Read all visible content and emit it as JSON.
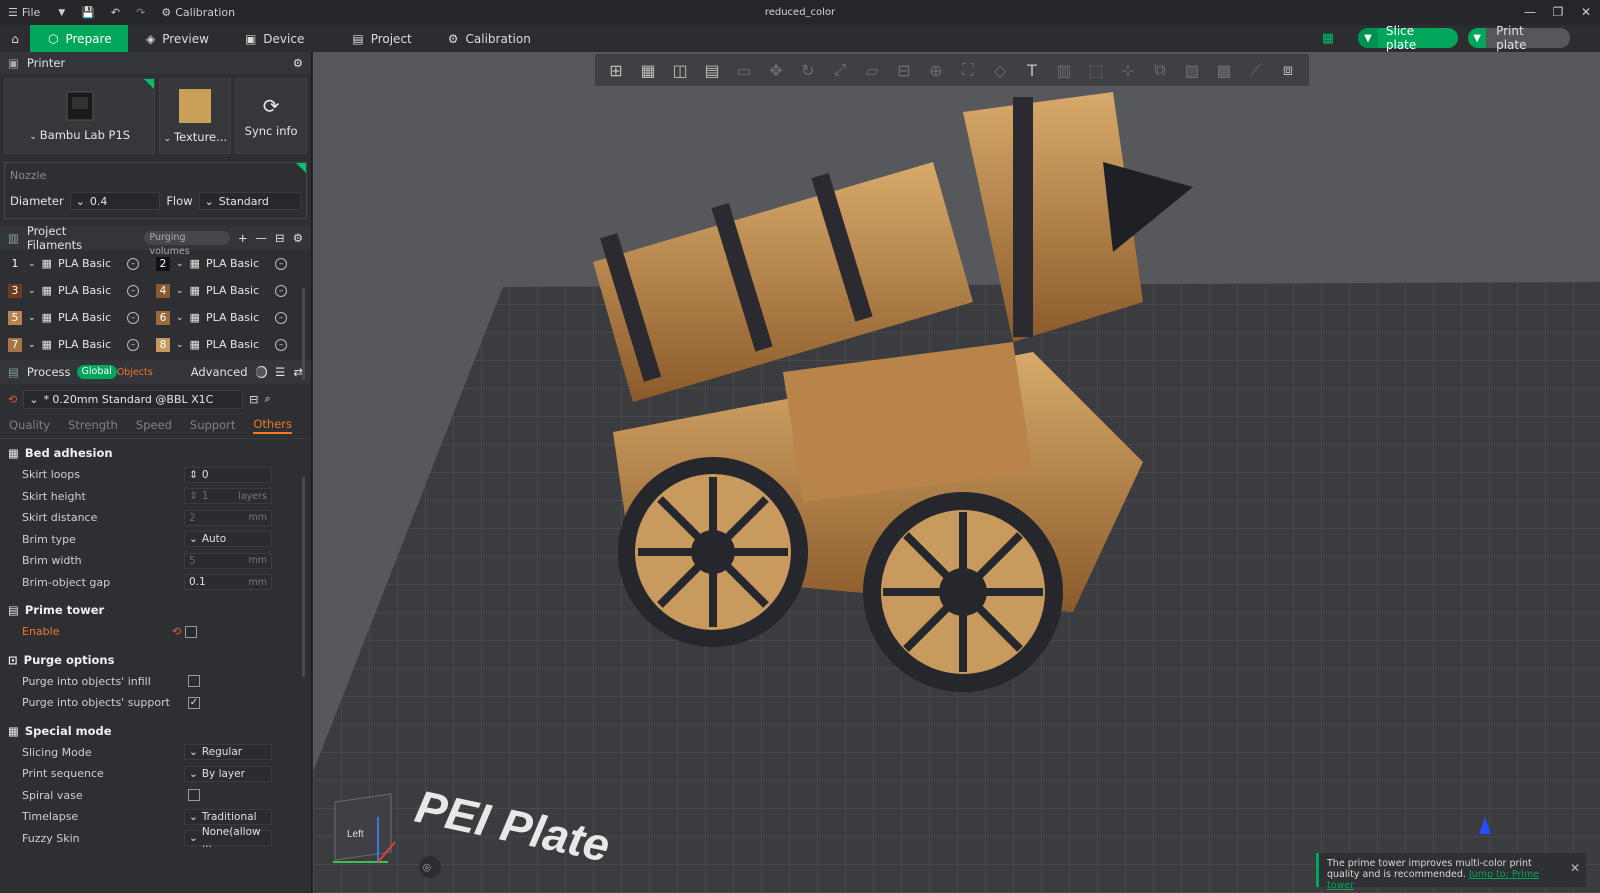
{
  "titlebar": {
    "file_label": "File",
    "calibration_label": "Calibration",
    "doc_title": "reduced_color"
  },
  "tabs": [
    {
      "label": "Prepare"
    },
    {
      "label": "Preview"
    },
    {
      "label": "Device"
    },
    {
      "label": "Project"
    },
    {
      "label": "Calibration"
    }
  ],
  "actions": {
    "slice": "Slice plate",
    "print": "Print plate"
  },
  "printer": {
    "header": "Printer",
    "model": "Bambu Lab P1S",
    "plate": "Texture...",
    "sync": "Sync info",
    "nozzle_label": "Nozzle",
    "diameter_label": "Diameter",
    "diameter_value": "0.4",
    "flow_label": "Flow",
    "flow_value": "Standard"
  },
  "filaments": {
    "header": "Project Filaments",
    "purging_label": "Purging volumes",
    "items": [
      {
        "num": "1",
        "name": "PLA Basic",
        "color": "#2d2f33"
      },
      {
        "num": "2",
        "name": "PLA Basic",
        "color": "#111111"
      },
      {
        "num": "3",
        "name": "PLA Basic",
        "color": "#6b3d1e"
      },
      {
        "num": "4",
        "name": "PLA Basic",
        "color": "#8a5a2f"
      },
      {
        "num": "5",
        "name": "PLA Basic",
        "color": "#b8844a"
      },
      {
        "num": "6",
        "name": "PLA Basic",
        "color": "#9b6a3a"
      },
      {
        "num": "7",
        "name": "PLA Basic",
        "color": "#a87444"
      },
      {
        "num": "8",
        "name": "PLA Basic",
        "color": "#c8995c"
      }
    ]
  },
  "process": {
    "header": "Process",
    "global_label": "Global",
    "objects_label": "Objects",
    "advanced_label": "Advanced",
    "preset": "* 0.20mm Standard @BBL X1C",
    "subtabs": [
      "Quality",
      "Strength",
      "Speed",
      "Support",
      "Others"
    ]
  },
  "bed_adhesion": {
    "title": "Bed adhesion",
    "skirt_loops_label": "Skirt loops",
    "skirt_loops_value": "0",
    "skirt_height_label": "Skirt height",
    "skirt_height_value": "1",
    "skirt_height_unit": "layers",
    "skirt_distance_label": "Skirt distance",
    "skirt_distance_value": "2",
    "skirt_distance_unit": "mm",
    "brim_type_label": "Brim type",
    "brim_type_value": "Auto",
    "brim_width_label": "Brim width",
    "brim_width_value": "5",
    "brim_width_unit": "mm",
    "brim_gap_label": "Brim-object gap",
    "brim_gap_value": "0.1",
    "brim_gap_unit": "mm"
  },
  "prime_tower": {
    "title": "Prime tower",
    "enable_label": "Enable"
  },
  "purge_options": {
    "title": "Purge options",
    "infill_label": "Purge into objects' infill",
    "support_label": "Purge into objects' support"
  },
  "special_mode": {
    "title": "Special mode",
    "slicing_label": "Slicing Mode",
    "slicing_value": "Regular",
    "sequence_label": "Print sequence",
    "sequence_value": "By layer",
    "spiral_label": "Spiral vase",
    "timelapse_label": "Timelapse",
    "timelapse_value": "Traditional",
    "fuzzy_label": "Fuzzy Skin",
    "fuzzy_value": "None(allow ..."
  },
  "viewport": {
    "plate_text": "PEI Plate",
    "view_cube_label": "Left",
    "notice_text": "The prime tower improves multi-color print quality and is recommended.",
    "notice_link": "Jump to: Prime tower"
  },
  "colors": {
    "accent": "#00a65a",
    "active_subtab": "#f07a2a",
    "enable_label": "#f07a2a"
  }
}
